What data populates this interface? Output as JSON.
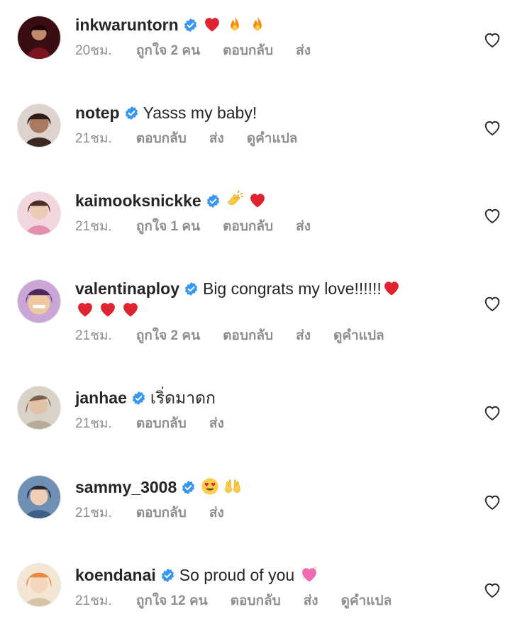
{
  "comments": [
    {
      "username": "inkwaruntorn",
      "text": "",
      "emojis": [
        "red-heart",
        "fire",
        "fire"
      ],
      "continuation_emojis": [],
      "time": "20ชม.",
      "likes": "ถูกใจ 2 คน",
      "reply": "ตอบกลับ",
      "send": "ส่ง",
      "translate": ""
    },
    {
      "username": "notep",
      "text": "Yasss my baby!",
      "emojis": [],
      "continuation_emojis": [],
      "time": "21ชม.",
      "likes": "",
      "reply": "ตอบกลับ",
      "send": "ส่ง",
      "translate": "ดูคำแปล"
    },
    {
      "username": "kaimooksnickke",
      "text": "",
      "emojis": [
        "clapping-hands",
        "red-heart"
      ],
      "continuation_emojis": [],
      "time": "21ชม.",
      "likes": "ถูกใจ 1 คน",
      "reply": "ตอบกลับ",
      "send": "ส่ง",
      "translate": ""
    },
    {
      "username": "valentinaploy",
      "text": "Big congrats my love!!!!!!",
      "emojis": [
        "red-heart"
      ],
      "continuation_emojis": [
        "red-heart",
        "red-heart",
        "red-heart"
      ],
      "time": "21ชม.",
      "likes": "ถูกใจ 2 คน",
      "reply": "ตอบกลับ",
      "send": "ส่ง",
      "translate": "ดูคำแปล"
    },
    {
      "username": "janhae",
      "text": "เริ่ดมาดก",
      "emojis": [],
      "continuation_emojis": [],
      "time": "21ชม.",
      "likes": "",
      "reply": "ตอบกลับ",
      "send": "ส่ง",
      "translate": ""
    },
    {
      "username": "sammy_3008",
      "text": "",
      "emojis": [
        "heart-eyes",
        "raising-hands"
      ],
      "continuation_emojis": [],
      "time": "21ชม.",
      "likes": "",
      "reply": "ตอบกลับ",
      "send": "ส่ง",
      "translate": ""
    },
    {
      "username": "koendanai",
      "text": "So proud of you",
      "emojis": [
        "sparkling-heart"
      ],
      "continuation_emojis": [],
      "time": "21ชม.",
      "likes": "ถูกใจ 12 คน",
      "reply": "ตอบกลับ",
      "send": "ส่ง",
      "translate": "ดูคำแปล"
    }
  ],
  "colors": {
    "verified_badge": "#3897f0",
    "meta_text": "#8e8e8e",
    "primary_text": "#262626",
    "heart_outline": "#262626"
  }
}
